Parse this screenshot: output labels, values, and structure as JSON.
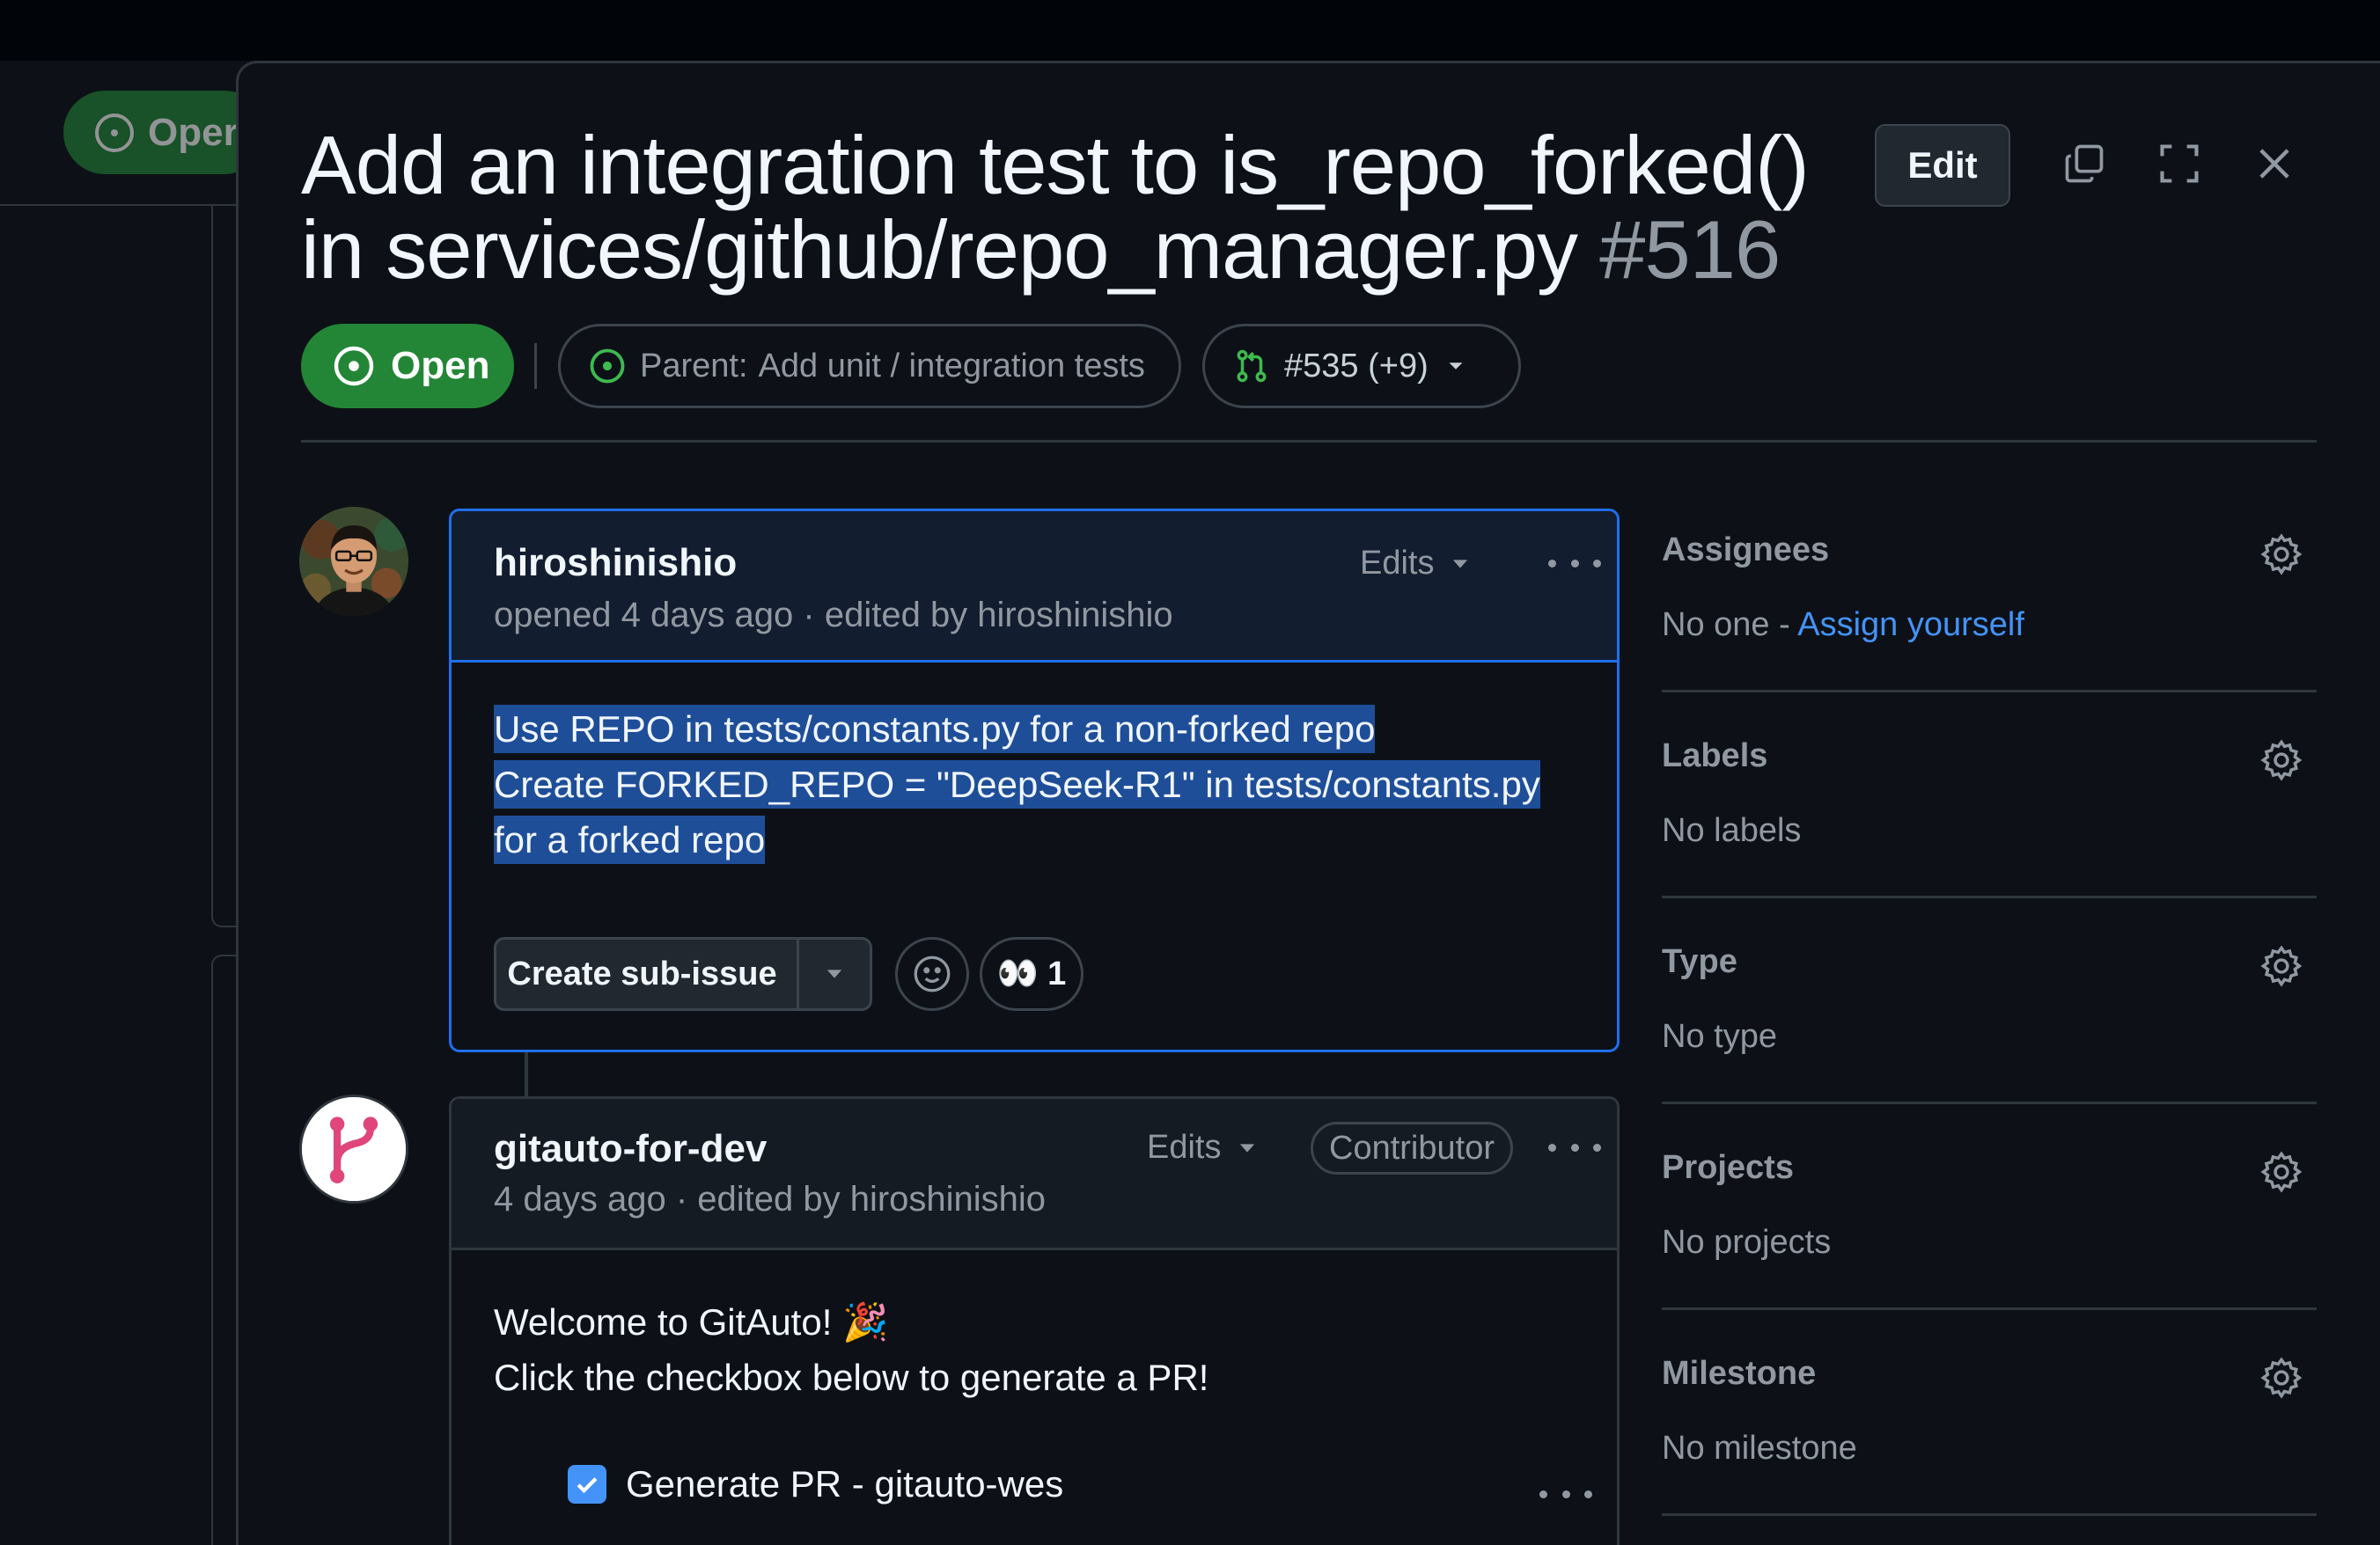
{
  "background": {
    "state_label": "Oper"
  },
  "issue": {
    "title": "Add an integration test to is_repo_forked() in services/github/repo_manager.py",
    "number": "#516",
    "state": "Open",
    "parent_label": "Parent:",
    "parent_title": "Add unit / integration tests",
    "linked_pr": "#535 (+9)"
  },
  "header": {
    "edit_label": "Edit"
  },
  "comments": [
    {
      "author": "hiroshinishio",
      "meta": "opened 4 days ago · edited by hiroshinishio",
      "edits_label": "Edits",
      "body_lines": [
        "Use REPO in tests/constants.py for a non-forked repo",
        "Create FORKED_REPO = \"DeepSeek-R1\" in tests/constants.py",
        "for a forked repo"
      ],
      "sub_issue_label": "Create sub-issue",
      "reaction_emoji": "👀",
      "reaction_count": "1"
    },
    {
      "author": "gitauto-for-dev",
      "meta": "4 days ago · edited by hiroshinishio",
      "edits_label": "Edits",
      "badge": "Contributor",
      "body_lines": [
        "Welcome to GitAuto! 🎉",
        "Click the checkbox below to generate a PR!"
      ],
      "checkbox_label": "Generate PR - gitauto-wes",
      "checkbox_checked": true
    }
  ],
  "sidebar": [
    {
      "title": "Assignees",
      "value": "No one - ",
      "link": "Assign yourself"
    },
    {
      "title": "Labels",
      "value": "No labels"
    },
    {
      "title": "Type",
      "value": "No type"
    },
    {
      "title": "Projects",
      "value": "No projects"
    },
    {
      "title": "Milestone",
      "value": "No milestone"
    }
  ],
  "colors": {
    "open_green": "#238636",
    "accent_blue": "#4493f8",
    "selection": "#1f4e99",
    "background": "#0d1117"
  }
}
